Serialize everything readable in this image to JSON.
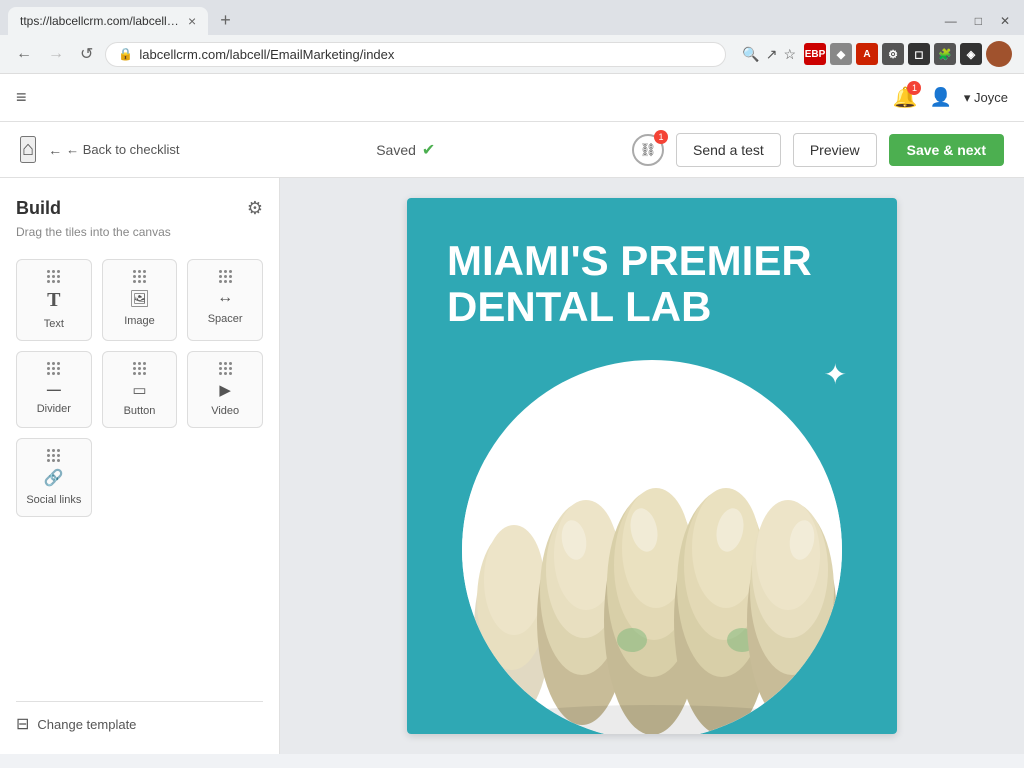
{
  "browser": {
    "tab_title": "ttps://labcellcrm.com/labcell/E...",
    "url": "labcellcrm.com/labcell/EmailMarketing/index",
    "tab_close": "×",
    "tab_new": "+"
  },
  "topbar": {
    "hamburger": "≡",
    "notification_badge": "1",
    "user_prefix": "▾ Joyce"
  },
  "toolbar": {
    "home_label": "⌂",
    "back_label": "← Back to checklist",
    "saved_label": "Saved",
    "send_test_label": "Send a test",
    "preview_label": "Preview",
    "save_next_label": "Save & next",
    "counter_badge": "1"
  },
  "sidebar": {
    "title": "Build",
    "subtitle": "Drag the tiles into the canvas",
    "tiles": [
      {
        "id": "text",
        "label": "Text",
        "icon": "T"
      },
      {
        "id": "image",
        "label": "Image",
        "icon": "⊞"
      },
      {
        "id": "spacer",
        "label": "Spacer",
        "icon": "⇔"
      },
      {
        "id": "divider",
        "label": "Divider",
        "icon": "—"
      },
      {
        "id": "button",
        "label": "Button",
        "icon": "▭"
      },
      {
        "id": "video",
        "label": "Video",
        "icon": "▶"
      }
    ],
    "single_tiles": [
      {
        "id": "social-links",
        "label": "Social links",
        "icon": "🔗"
      }
    ],
    "change_template_label": "Change template",
    "change_template_icon": "⊟"
  },
  "email_content": {
    "headline_line1": "MIAMI'S PREMIER",
    "headline_line2": "DENTAL LAB"
  },
  "colors": {
    "teal": "#2fa8b4",
    "green": "#4caf50",
    "white": "#ffffff"
  }
}
